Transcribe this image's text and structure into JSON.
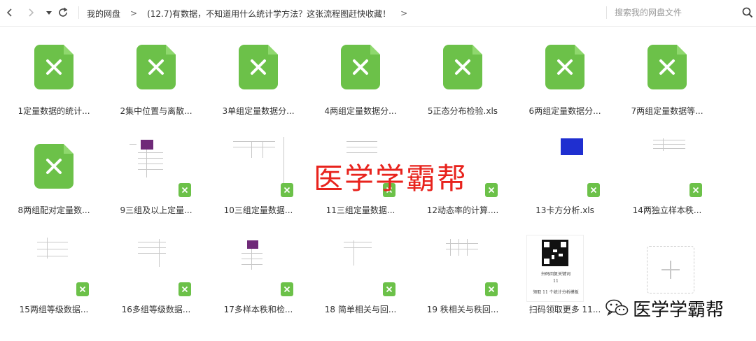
{
  "toolbar": {
    "back_icon": "chevron-left-icon",
    "forward_icon": "chevron-right-icon",
    "history_icon": "caret-down-icon",
    "refresh_icon": "refresh-icon"
  },
  "breadcrumb": {
    "root": "我的网盘",
    "separator": ">",
    "current": "(12.7)有数据，不知道用什么统计学方法？这张流程图赶快收藏！",
    "trailing_separator": ">"
  },
  "search": {
    "placeholder": "搜索我的网盘文件",
    "value": ""
  },
  "colors": {
    "excel_green": "#6cc149",
    "watermark_red": "#e8231d"
  },
  "files": [
    {
      "label": "1定量数据的统计...",
      "thumb": "xls-icon"
    },
    {
      "label": "2集中位置与离散...",
      "thumb": "xls-icon"
    },
    {
      "label": "3单组定量数据分...",
      "thumb": "xls-icon"
    },
    {
      "label": "4两组定量数据分...",
      "thumb": "xls-icon"
    },
    {
      "label": "5正态分布检验.xls",
      "thumb": "xls-icon"
    },
    {
      "label": "6两组定量数据分...",
      "thumb": "xls-icon"
    },
    {
      "label": "7两组定量数据等...",
      "thumb": "xls-icon"
    },
    {
      "label": "8两组配对定量数...",
      "thumb": "xls-icon"
    },
    {
      "label": "9三组及以上定量...",
      "thumb": "sheet-preview"
    },
    {
      "label": "10三组定量数据...",
      "thumb": "sheet-preview"
    },
    {
      "label": "11三组定量数据...",
      "thumb": "sheet-preview"
    },
    {
      "label": "12动态率的计算....",
      "thumb": "sheet-preview"
    },
    {
      "label": "13卡方分析.xls",
      "thumb": "sheet-preview"
    },
    {
      "label": "14两独立样本秩...",
      "thumb": "sheet-preview"
    },
    {
      "label": "15两组等级数据...",
      "thumb": "sheet-preview"
    },
    {
      "label": "16多组等级数据...",
      "thumb": "sheet-preview"
    },
    {
      "label": "17多样本秩和检...",
      "thumb": "sheet-preview"
    },
    {
      "label": "18 简单相关与回...",
      "thumb": "sheet-preview"
    },
    {
      "label": "19 秩相关与秩回...",
      "thumb": "sheet-preview"
    },
    {
      "label": "扫码领取更多 11...",
      "thumb": "qr-image"
    }
  ],
  "qr_card": {
    "line1": "扫码回复关键词",
    "line2": "11",
    "line3": "领取 11 个统计分析模板"
  },
  "add_tile_icon": "plus-icon",
  "watermark": {
    "center_text": "医学学霸帮",
    "corner_text": "医学学霸帮",
    "corner_icon": "wechat-icon"
  }
}
